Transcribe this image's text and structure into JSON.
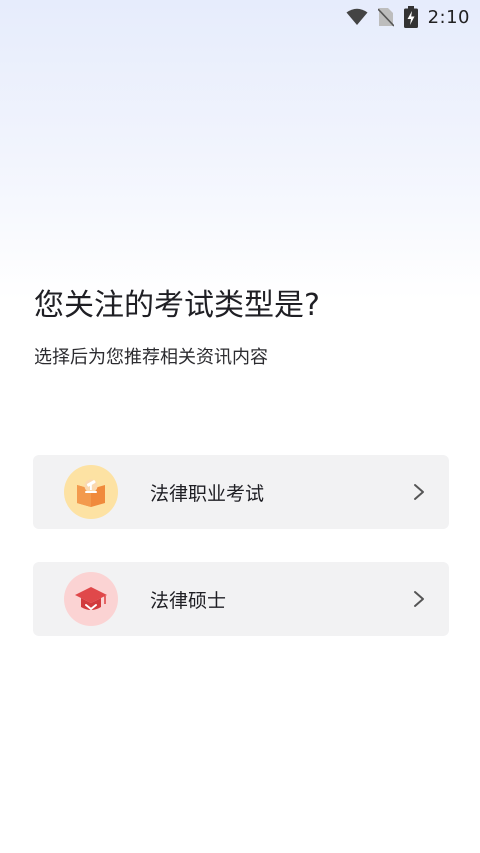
{
  "status_bar": {
    "time": "2:10",
    "icons": [
      "wifi-icon",
      "no-sim-icon",
      "battery-charging-icon"
    ]
  },
  "main": {
    "question": "您关注的考试类型是?",
    "subtitle": "选择后为您推荐相关资讯内容"
  },
  "options": [
    {
      "label": "法律职业考试",
      "icon": "gavel-book-icon",
      "icon_color": "#f08a3c",
      "bg_color": "#fde2a3"
    },
    {
      "label": "法律硕士",
      "icon": "graduation-cap-icon",
      "icon_color": "#e0484a",
      "bg_color": "#fbd3d3"
    }
  ],
  "colors": {
    "gradient_top": "#e6ecfc",
    "card_bg": "#f2f2f3",
    "text_primary": "#1f1f24"
  }
}
